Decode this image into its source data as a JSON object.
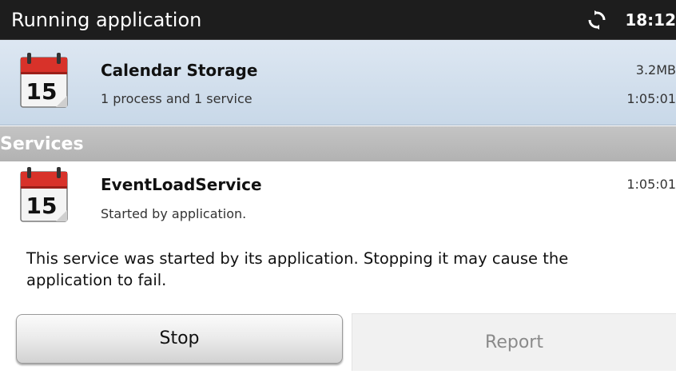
{
  "status_bar": {
    "title": "Running application",
    "time": "18:12",
    "sync_icon": "sync-icon"
  },
  "app": {
    "icon": "calendar-icon",
    "icon_day": "15",
    "name": "Calendar Storage",
    "summary": "1 process and 1 service",
    "memory": "3.2MB",
    "elapsed": "1:05:01"
  },
  "services_header": "Services",
  "service": {
    "icon": "calendar-icon",
    "icon_day": "15",
    "name": "EventLoadService",
    "status": "Started by application.",
    "elapsed": "1:05:01"
  },
  "description": "This service was started by its application. Stopping it may cause the application to fail.",
  "buttons": {
    "stop": "Stop",
    "report": "Report"
  },
  "colors": {
    "title_bar": "#1d1d1d",
    "selected_row": "#cdd9e6",
    "section_header": "#bababa",
    "calendar_red": "#d8322a"
  }
}
